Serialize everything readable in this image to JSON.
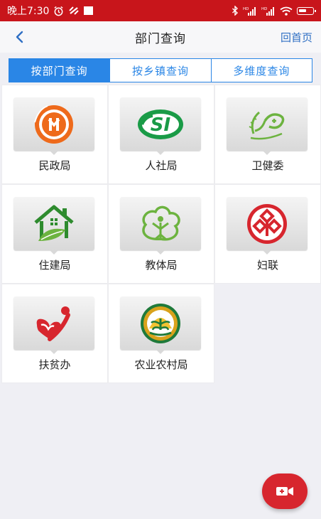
{
  "status_bar": {
    "time": "晚上7:30",
    "network_label": "HD"
  },
  "nav": {
    "title": "部门查询",
    "home": "回首页"
  },
  "tabs": [
    {
      "label": "按部门查询",
      "active": true
    },
    {
      "label": "按乡镇查询",
      "active": false
    },
    {
      "label": "多维度查询",
      "active": false
    }
  ],
  "departments": [
    {
      "label": "民政局",
      "icon": "civil-affairs-logo"
    },
    {
      "label": "人社局",
      "icon": "social-security-logo"
    },
    {
      "label": "卫健委",
      "icon": "health-commission-logo"
    },
    {
      "label": "住建局",
      "icon": "housing-construction-logo"
    },
    {
      "label": "教体局",
      "icon": "education-sports-logo"
    },
    {
      "label": "妇联",
      "icon": "womens-federation-logo"
    },
    {
      "label": "扶贫办",
      "icon": "poverty-alleviation-logo"
    },
    {
      "label": "农业农村局",
      "icon": "agriculture-rural-logo"
    }
  ],
  "colors": {
    "status_bar": "#c8151b",
    "accent": "#2a86e6",
    "fab": "#d7262e"
  }
}
